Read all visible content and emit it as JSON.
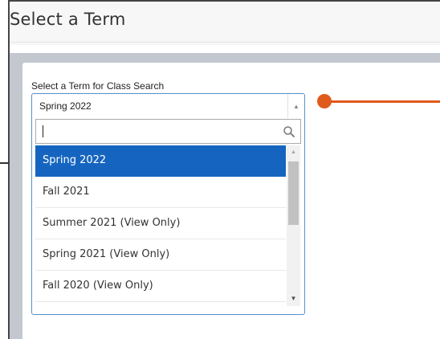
{
  "page": {
    "title": "Select a Term"
  },
  "term_select": {
    "label": "Select a Term for Class Search",
    "selected_value": "Spring 2022",
    "search": {
      "value": "",
      "placeholder": ""
    },
    "options": [
      {
        "label": "Spring 2022",
        "highlighted": true
      },
      {
        "label": "Fall 2021",
        "highlighted": false
      },
      {
        "label": "Summer 2021 (View Only)",
        "highlighted": false
      },
      {
        "label": "Spring 2021 (View Only)",
        "highlighted": false
      },
      {
        "label": "Fall 2020 (View Only)",
        "highlighted": false
      }
    ],
    "icons": {
      "search": "search-icon",
      "dropdown_toggle": "chevron-up-icon",
      "scroll_up": "scroll-up-arrow",
      "scroll_down": "scroll-down-arrow"
    }
  },
  "colors": {
    "highlight": "#1565c0",
    "annotation": "#e05a1c",
    "content_band": "#c3c8cf",
    "combo_border": "#5b8ecb"
  }
}
